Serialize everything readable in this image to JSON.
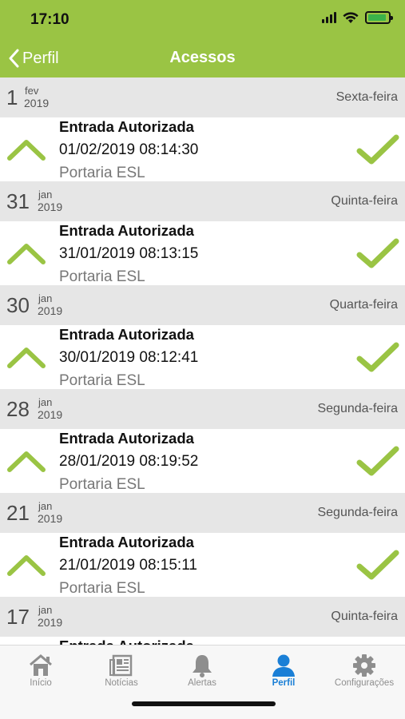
{
  "status_bar": {
    "time": "17:10"
  },
  "nav": {
    "back_label": "Perfil",
    "title": "Acessos"
  },
  "colors": {
    "brand": "#9ac444",
    "accent_active": "#1a7fd6",
    "check": "#9ac444"
  },
  "days": [
    {
      "day": "1",
      "month": "fev",
      "year": "2019",
      "weekday": "Sexta-feira",
      "entry": {
        "title": "Entrada Autorizada",
        "datetime": "01/02/2019 08:14:30",
        "location": "Portaria ESL"
      }
    },
    {
      "day": "31",
      "month": "jan",
      "year": "2019",
      "weekday": "Quinta-feira",
      "entry": {
        "title": "Entrada Autorizada",
        "datetime": "31/01/2019 08:13:15",
        "location": "Portaria ESL"
      }
    },
    {
      "day": "30",
      "month": "jan",
      "year": "2019",
      "weekday": "Quarta-feira",
      "entry": {
        "title": "Entrada Autorizada",
        "datetime": "30/01/2019 08:12:41",
        "location": "Portaria ESL"
      }
    },
    {
      "day": "28",
      "month": "jan",
      "year": "2019",
      "weekday": "Segunda-feira",
      "entry": {
        "title": "Entrada Autorizada",
        "datetime": "28/01/2019 08:19:52",
        "location": "Portaria ESL"
      }
    },
    {
      "day": "21",
      "month": "jan",
      "year": "2019",
      "weekday": "Segunda-feira",
      "entry": {
        "title": "Entrada Autorizada",
        "datetime": "21/01/2019 08:15:11",
        "location": "Portaria ESL"
      }
    },
    {
      "day": "17",
      "month": "jan",
      "year": "2019",
      "weekday": "Quinta-feira",
      "entry": {
        "title": "Entrada Autorizada",
        "datetime": "",
        "location": ""
      }
    }
  ],
  "tabs": [
    {
      "label": "Início",
      "icon": "home-icon"
    },
    {
      "label": "Notícias",
      "icon": "newspaper-icon"
    },
    {
      "label": "Alertas",
      "icon": "bell-icon"
    },
    {
      "label": "Perfil",
      "icon": "person-icon",
      "active": true
    },
    {
      "label": "Configurações",
      "icon": "gear-icon"
    }
  ]
}
